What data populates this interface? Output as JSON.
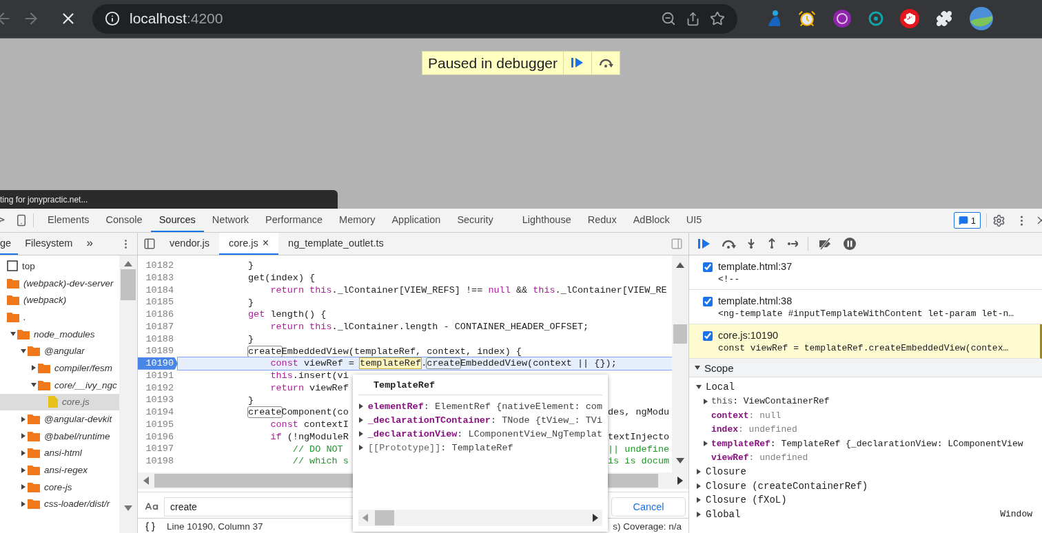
{
  "browser": {
    "url_host": "localhost",
    "url_port": ":4200"
  },
  "page": {
    "paused_banner": "Paused in debugger",
    "status_text": "ting for jonypractic.net..."
  },
  "devtools": {
    "tabs": [
      {
        "label": "Elements",
        "selected": false
      },
      {
        "label": "Console",
        "selected": false
      },
      {
        "label": "Sources",
        "selected": true
      },
      {
        "label": "Network",
        "selected": false
      },
      {
        "label": "Performance",
        "selected": false
      },
      {
        "label": "Memory",
        "selected": false
      },
      {
        "label": "Application",
        "selected": false
      },
      {
        "label": "Security",
        "selected": false
      },
      {
        "label": "Lighthouse",
        "selected": false
      },
      {
        "label": "Redux",
        "selected": false
      },
      {
        "label": "AdBlock",
        "selected": false
      },
      {
        "label": "UI5",
        "selected": false
      }
    ],
    "issues_count": "1"
  },
  "navigator": {
    "tabs": [
      {
        "label": "ge",
        "selected": true
      },
      {
        "label": "Filesystem",
        "selected": false
      }
    ],
    "more": "»",
    "tree": [
      {
        "label": "top",
        "kind": "frame"
      },
      {
        "label": "(webpack)-dev-server",
        "kind": "folder"
      },
      {
        "label": "(webpack)",
        "kind": "folder"
      },
      {
        "label": ".",
        "kind": "folder",
        "children": [
          {
            "label": "node_modules",
            "kind": "folder",
            "expanded": true,
            "children": [
              {
                "label": "@angular",
                "kind": "folder",
                "expanded": true,
                "children": [
                  {
                    "label": "compiler/fesm",
                    "kind": "folder",
                    "expanded": false
                  },
                  {
                    "label": "core/__ivy_ngc",
                    "kind": "folder",
                    "expanded": true,
                    "children": [
                      {
                        "label": "core.js",
                        "kind": "file",
                        "selected": true
                      }
                    ]
                  }
                ]
              },
              {
                "label": "@angular-devkit",
                "kind": "folder",
                "expanded": false
              },
              {
                "label": "@babel/runtime",
                "kind": "folder",
                "expanded": false
              },
              {
                "label": "ansi-html",
                "kind": "folder",
                "expanded": false
              },
              {
                "label": "ansi-regex",
                "kind": "folder",
                "expanded": false
              },
              {
                "label": "core-js",
                "kind": "folder",
                "expanded": false
              },
              {
                "label": "css-loader/dist/r",
                "kind": "folder",
                "expanded": false
              }
            ]
          }
        ]
      }
    ]
  },
  "editor": {
    "tabs": [
      {
        "label": "vendor.js",
        "selected": false,
        "closable": false
      },
      {
        "label": "core.js",
        "selected": true,
        "closable": true
      },
      {
        "label": "ng_template_outlet.ts",
        "selected": false,
        "closable": false
      }
    ],
    "close_glyph": "×",
    "lines": [
      {
        "number": "10182",
        "current": false,
        "segments": [
          {
            "text": "}",
            "kind": "plain"
          }
        ]
      },
      {
        "number": "10183",
        "current": false,
        "segments": [
          {
            "text": "get(index) {",
            "kind": "plain"
          }
        ]
      },
      {
        "number": "10184",
        "current": false,
        "segments": [
          {
            "text": "    return this",
            "kind": "keyword"
          },
          {
            "text": "._lContainer[VIEW_REFS] !== ",
            "kind": "plain"
          },
          {
            "text": "null",
            "kind": "keyword"
          },
          {
            "text": " && ",
            "kind": "plain"
          },
          {
            "text": "this",
            "kind": "keyword"
          },
          {
            "text": "._lContainer[VIEW_RE",
            "kind": "plain"
          }
        ]
      },
      {
        "number": "10185",
        "current": false,
        "segments": [
          {
            "text": "}",
            "kind": "plain"
          }
        ]
      },
      {
        "number": "10186",
        "current": false,
        "segments": [
          {
            "text": "get",
            "kind": "keyword"
          },
          {
            "text": " length() {",
            "kind": "plain"
          }
        ]
      },
      {
        "number": "10187",
        "current": false,
        "segments": [
          {
            "text": "    return this",
            "kind": "keyword"
          },
          {
            "text": "._lContainer.length - CONTAINER_HEADER_OFFSET;",
            "kind": "plain"
          }
        ]
      },
      {
        "number": "10188",
        "current": false,
        "segments": [
          {
            "text": "}",
            "kind": "plain"
          }
        ]
      },
      {
        "number": "10189",
        "current": false,
        "segments": [
          {
            "text": "create",
            "kind": "match"
          },
          {
            "text": "EmbeddedView(templateRef, context, index) {",
            "kind": "plain"
          }
        ]
      },
      {
        "number": "10190",
        "current": true,
        "segments": [
          {
            "text": "    const",
            "kind": "keyword"
          },
          {
            "text": " viewRef = ",
            "kind": "plain"
          },
          {
            "text": "templateRef",
            "kind": "hovered"
          },
          {
            "text": ".",
            "kind": "plain"
          },
          {
            "text": "create",
            "kind": "match"
          },
          {
            "text": "EmbeddedView(context || {});",
            "kind": "plain"
          }
        ]
      },
      {
        "number": "10191",
        "current": false,
        "segments": [
          {
            "text": "    this",
            "kind": "keyword"
          },
          {
            "text": ".insert(vi",
            "kind": "plain"
          }
        ]
      },
      {
        "number": "10192",
        "current": false,
        "segments": [
          {
            "text": "    return",
            "kind": "keyword"
          },
          {
            "text": " viewRef",
            "kind": "plain"
          }
        ]
      },
      {
        "number": "10193",
        "current": false,
        "segments": [
          {
            "text": "}",
            "kind": "plain"
          }
        ]
      },
      {
        "number": "10194",
        "current": false,
        "segments": [
          {
            "text": "create",
            "kind": "match"
          },
          {
            "text": "Component(co",
            "kind": "plain"
          }
        ],
        "after": [
          {
            "text": "des, ngModu",
            "kind": "plain"
          }
        ]
      },
      {
        "number": "10195",
        "current": false,
        "segments": [
          {
            "text": "    const",
            "kind": "keyword"
          },
          {
            "text": " contextI",
            "kind": "plain"
          }
        ]
      },
      {
        "number": "10196",
        "current": false,
        "segments": [
          {
            "text": "    if",
            "kind": "keyword"
          },
          {
            "text": " (!ngModuleR",
            "kind": "plain"
          }
        ],
        "after": [
          {
            "text": "textInjecto",
            "kind": "plain"
          }
        ]
      },
      {
        "number": "10197",
        "current": false,
        "segments": [
          {
            "text": "        // DO NOT",
            "kind": "comment"
          }
        ],
        "after": [
          {
            "text": "|| undefine",
            "kind": "comment"
          }
        ]
      },
      {
        "number": "10198",
        "current": false,
        "segments": [
          {
            "text": "        // which s",
            "kind": "comment"
          }
        ],
        "after": [
          {
            "text": "is is docum",
            "kind": "comment"
          }
        ]
      }
    ],
    "popover": {
      "title": "TemplateRef",
      "properties": [
        {
          "name": "elementRef",
          "value": ": ElementRef {nativeElement: com",
          "kind": "own"
        },
        {
          "name": "_declarationTContainer",
          "value": ": TNode {tView_: TVi",
          "kind": "own"
        },
        {
          "name": "_declarationView",
          "value": ": LComponentView_NgTemplat",
          "kind": "own"
        },
        {
          "name": "[[Prototype]]",
          "value": ": TemplateRef",
          "kind": "internal"
        }
      ]
    },
    "search": {
      "value": "create",
      "cancel": "Cancel"
    },
    "status": {
      "cursor": "Line 10190, Column 37",
      "coverage": "s) Coverage: n/a"
    }
  },
  "debugger": {
    "breakpoints": [
      {
        "location": "template.html:37",
        "snippet": "<!--",
        "checked": true,
        "current": false
      },
      {
        "location": "template.html:38",
        "snippet": "<ng-template #inputTemplateWithContent let-param let-n…",
        "checked": true,
        "current": false
      },
      {
        "location": "core.js:10190",
        "snippet": "const viewRef = templateRef.createEmbeddedView(contex…",
        "checked": true,
        "current": true
      }
    ],
    "scope": {
      "title": "Scope",
      "expanded": true,
      "sections": [
        {
          "name": "Local",
          "expanded": true,
          "vars": [
            {
              "name": "this",
              "value": ": ViewContainerRef",
              "kind": "receiver",
              "expandable": true
            },
            {
              "name": "context",
              "value": ": null",
              "kind": "empty",
              "expandable": false
            },
            {
              "name": "index",
              "value": ": undefined",
              "kind": "empty",
              "expandable": false
            },
            {
              "name": "templateRef",
              "value": ": TemplateRef {_declarationView: LComponentView",
              "kind": "object",
              "expandable": true
            },
            {
              "name": "viewRef",
              "value": ": undefined",
              "kind": "empty",
              "expandable": false
            }
          ]
        },
        {
          "name": "Closure",
          "expanded": false
        },
        {
          "name": "Closure (createContainerRef)",
          "expanded": false
        },
        {
          "name": "Closure (fXoL)",
          "expanded": false
        },
        {
          "name": "Global",
          "expanded": false,
          "value": "Window"
        }
      ]
    }
  }
}
